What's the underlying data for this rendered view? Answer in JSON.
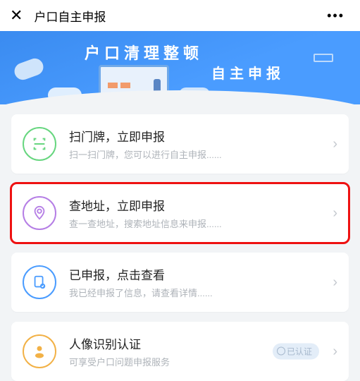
{
  "header": {
    "close_icon": "close",
    "title": "户口自主申报",
    "more_icon": "more"
  },
  "banner": {
    "title_line1": "户口清理整顿",
    "title_line2": "自主申报"
  },
  "cards": [
    {
      "id": "scan",
      "icon_name": "scan-icon",
      "icon_color": "green",
      "title": "扫门牌，立即申报",
      "subtitle": "扫一扫门牌，您可以进行自主申报......",
      "highlight": false
    },
    {
      "id": "search",
      "icon_name": "location-pin-icon",
      "icon_color": "purple",
      "title": "查地址，立即申报",
      "subtitle": "查一查地址，搜索地址信息来申报......",
      "highlight": true
    },
    {
      "id": "reported",
      "icon_name": "document-check-icon",
      "icon_color": "blue",
      "title": "已申报，点击查看",
      "subtitle": "我已经申报了信息，请查看详情......",
      "highlight": false
    },
    {
      "id": "face",
      "icon_name": "face-id-icon",
      "icon_color": "orange",
      "title": "人像识别认证",
      "subtitle": "可享受户口问题申报服务",
      "highlight": false,
      "badge": "已认证"
    }
  ]
}
